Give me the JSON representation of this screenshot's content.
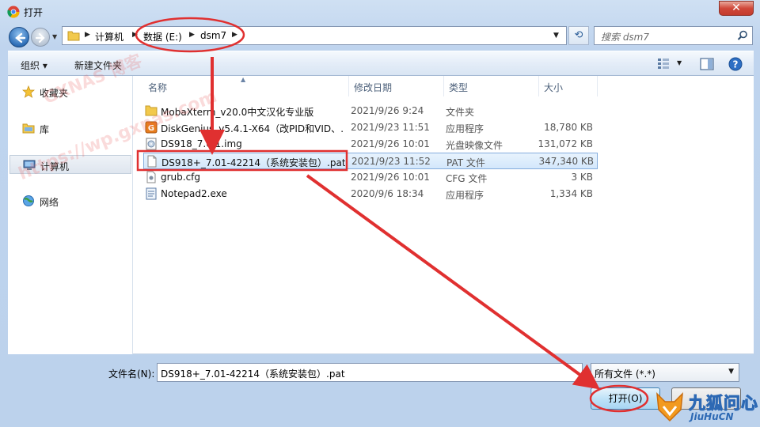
{
  "window": {
    "title": "打开",
    "close_label": "✕"
  },
  "address": {
    "crumbs": [
      "计算机",
      "数据 (E:)",
      "dsm7"
    ],
    "search_placeholder": "搜索 dsm7"
  },
  "toolbar": {
    "organize_label": "组织 ▾",
    "new_folder_label": "新建文件夹"
  },
  "nav": {
    "items": [
      {
        "label": "收藏夹",
        "icon": "star-icon"
      },
      {
        "label": "库",
        "icon": "library-icon"
      },
      {
        "label": "计算机",
        "icon": "computer-icon",
        "selected": true
      },
      {
        "label": "网络",
        "icon": "network-icon"
      }
    ]
  },
  "columns": [
    "名称",
    "修改日期",
    "类型",
    "大小"
  ],
  "files": [
    {
      "name": "MobaXterm_v20.0中文汉化专业版",
      "date": "2021/9/26 9:24",
      "type": "文件夹",
      "size": "",
      "icon": "folder-icon"
    },
    {
      "name": "DiskGenius_v5.4.1-X64（改PID和VID、…",
      "date": "2021/9/23 11:51",
      "type": "应用程序",
      "size": "18,780 KB",
      "icon": "app-icon"
    },
    {
      "name": "DS918_7.0.1.img",
      "date": "2021/9/26 10:01",
      "type": "光盘映像文件",
      "size": "131,072 KB",
      "icon": "disc-image-icon"
    },
    {
      "name": "DS918+_7.01-42214（系统安装包）.pat",
      "date": "2021/9/23 11:52",
      "type": "PAT 文件",
      "size": "347,340 KB",
      "icon": "file-icon",
      "selected": true
    },
    {
      "name": "grub.cfg",
      "date": "2021/9/26 10:01",
      "type": "CFG 文件",
      "size": "3 KB",
      "icon": "config-file-icon"
    },
    {
      "name": "Notepad2.exe",
      "date": "2020/9/6 18:34",
      "type": "应用程序",
      "size": "1,334 KB",
      "icon": "exe-icon"
    }
  ],
  "bottom": {
    "filename_label": "文件名(N):",
    "filename_value": "DS918+_7.01-42214（系统安装包）.pat",
    "filetype_value": "所有文件 (*.*)",
    "open_label": "打开(O)"
  },
  "watermarks": [
    "GXNAS 博客",
    "https://wp.gxnas.com"
  ],
  "logo": {
    "cn": "九狐问心",
    "en": "JiuHuCN"
  },
  "colors": {
    "annotation_red": "#e03030",
    "accent_blue": "#2d69b4"
  }
}
